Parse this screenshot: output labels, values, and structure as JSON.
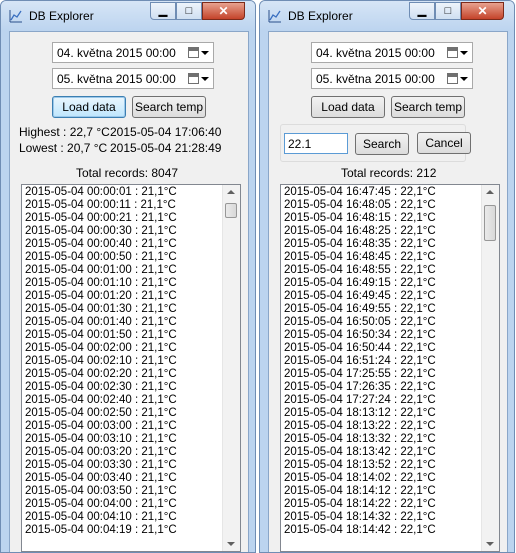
{
  "left": {
    "title": "DB Explorer",
    "date_from": "04.  května  2015 00:00",
    "date_to": "05.  května  2015 00:00",
    "load_button": "Load data",
    "search_temp_button": "Search temp",
    "highest_label": "Highest : 22,7 °C",
    "highest_time": "2015-05-04 17:06:40",
    "lowest_label": "Lowest : 20,7 °C",
    "lowest_time": "2015-05-04 21:28:49",
    "total_records": "Total records: 8047",
    "records": [
      "2015-05-04 00:00:01 : 21,1°C",
      "2015-05-04 00:00:11 : 21,1°C",
      "2015-05-04 00:00:21 : 21,1°C",
      "2015-05-04 00:00:30 : 21,1°C",
      "2015-05-04 00:00:40 : 21,1°C",
      "2015-05-04 00:00:50 : 21,1°C",
      "2015-05-04 00:01:00 : 21,1°C",
      "2015-05-04 00:01:10 : 21,1°C",
      "2015-05-04 00:01:20 : 21,1°C",
      "2015-05-04 00:01:30 : 21,1°C",
      "2015-05-04 00:01:40 : 21,1°C",
      "2015-05-04 00:01:50 : 21,1°C",
      "2015-05-04 00:02:00 : 21,1°C",
      "2015-05-04 00:02:10 : 21,1°C",
      "2015-05-04 00:02:20 : 21,1°C",
      "2015-05-04 00:02:30 : 21,1°C",
      "2015-05-04 00:02:40 : 21,1°C",
      "2015-05-04 00:02:50 : 21,1°C",
      "2015-05-04 00:03:00 : 21,1°C",
      "2015-05-04 00:03:10 : 21,1°C",
      "2015-05-04 00:03:20 : 21,1°C",
      "2015-05-04 00:03:30 : 21,1°C",
      "2015-05-04 00:03:40 : 21,1°C",
      "2015-05-04 00:03:50 : 21,1°C",
      "2015-05-04 00:04:00 : 21,1°C",
      "2015-05-04 00:04:10 : 21,1°C",
      "2015-05-04 00:04:19 : 21,1°C"
    ]
  },
  "right": {
    "title": "DB Explorer",
    "date_from": "04.  května  2015 00:00",
    "date_to": "05.  května  2015 00:00",
    "load_button": "Load data",
    "search_temp_button": "Search temp",
    "search_value": "22.1",
    "search_button": "Search",
    "cancel_button": "Cancel",
    "total_records": "Total records: 212",
    "records": [
      "2015-05-04 16:47:45 : 22,1°C",
      "2015-05-04 16:48:05 : 22,1°C",
      "2015-05-04 16:48:15 : 22,1°C",
      "2015-05-04 16:48:25 : 22,1°C",
      "2015-05-04 16:48:35 : 22,1°C",
      "2015-05-04 16:48:45 : 22,1°C",
      "2015-05-04 16:48:55 : 22,1°C",
      "2015-05-04 16:49:15 : 22,1°C",
      "2015-05-04 16:49:45 : 22,1°C",
      "2015-05-04 16:49:55 : 22,1°C",
      "2015-05-04 16:50:05 : 22,1°C",
      "2015-05-04 16:50:34 : 22,1°C",
      "2015-05-04 16:50:44 : 22,1°C",
      "2015-05-04 16:51:24 : 22,1°C",
      "2015-05-04 17:25:55 : 22,1°C",
      "2015-05-04 17:26:35 : 22,1°C",
      "2015-05-04 17:27:24 : 22,1°C",
      "2015-05-04 18:13:12 : 22,1°C",
      "2015-05-04 18:13:22 : 22,1°C",
      "2015-05-04 18:13:32 : 22,1°C",
      "2015-05-04 18:13:42 : 22,1°C",
      "2015-05-04 18:13:52 : 22,1°C",
      "2015-05-04 18:14:02 : 22,1°C",
      "2015-05-04 18:14:12 : 22,1°C",
      "2015-05-04 18:14:22 : 22,1°C",
      "2015-05-04 18:14:32 : 22,1°C",
      "2015-05-04 18:14:42 : 22,1°C"
    ]
  }
}
